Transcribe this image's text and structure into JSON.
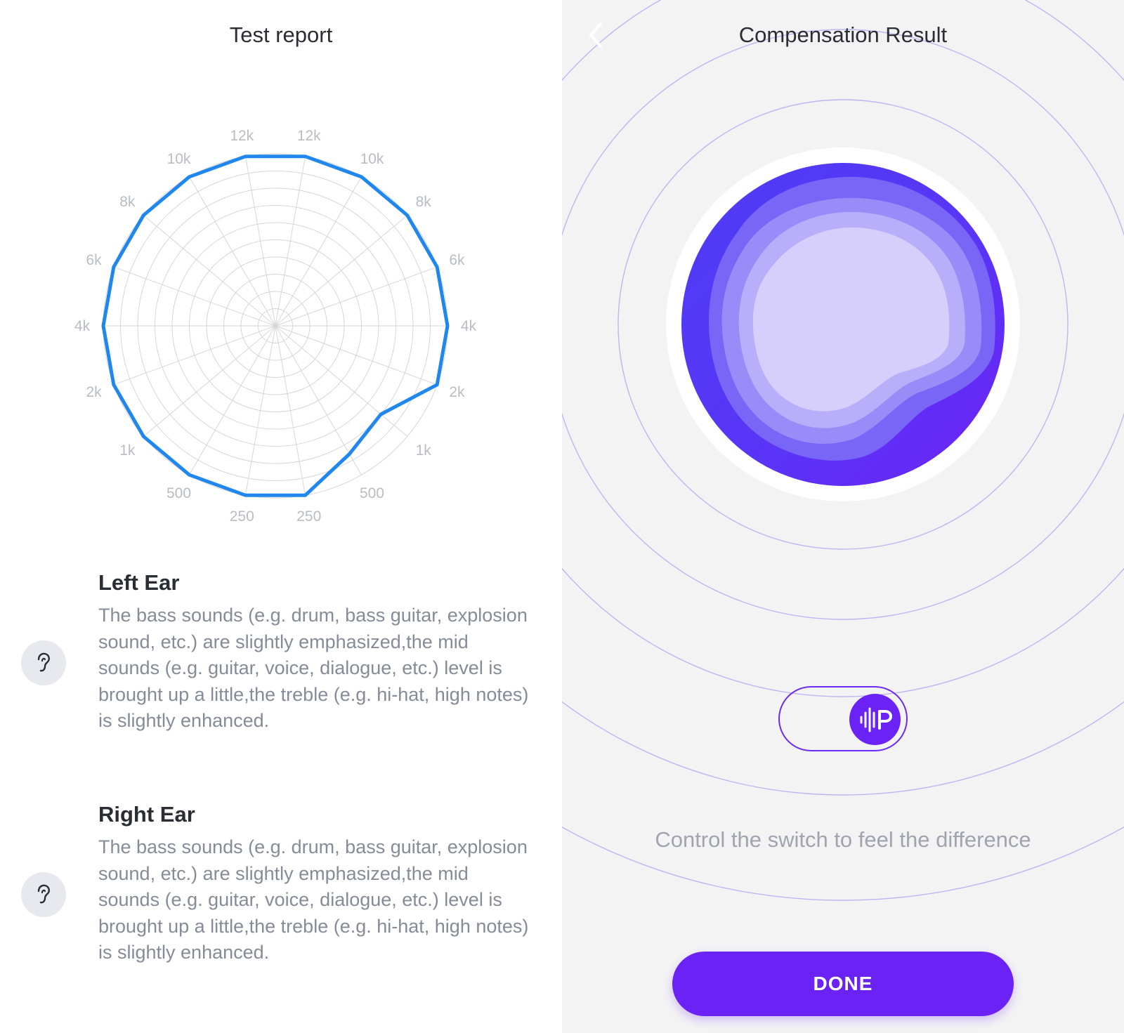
{
  "left": {
    "title": "Test report",
    "left_ear": {
      "heading": "Left Ear",
      "text": "The bass sounds (e.g. drum, bass guitar, explosion sound, etc.) are slightly emphasized,the mid sounds (e.g. guitar, voice, dialogue, etc.) level is brought up a little,the treble (e.g. hi-hat, high notes) is slightly enhanced.",
      "icon": "left-ear-icon"
    },
    "right_ear": {
      "heading": "Right Ear",
      "text": "The bass sounds (e.g. drum, bass guitar, explosion sound, etc.) are slightly emphasized,the mid sounds (e.g. guitar, voice, dialogue, etc.) level is brought up a little,the treble (e.g. hi-hat, high notes) is slightly enhanced.",
      "icon": "right-ear-icon"
    }
  },
  "right": {
    "title": "Compensation Result",
    "back_icon": "chevron-left-icon",
    "toggle_icon": "waveform-p-icon",
    "hint": "Control the switch to feel the difference",
    "done_label": "DONE"
  },
  "colors": {
    "radar_line": "#1f87ee",
    "grid": "#d6d6d9",
    "accent": "#6b22f5",
    "ring": "#b7b0f3",
    "tick_label": "#b9bcc3"
  },
  "chart_data": {
    "type": "radar",
    "title": "",
    "axes": [
      "12k",
      "10k",
      "8k",
      "6k",
      "4k",
      "2k",
      "1k",
      "500",
      "250",
      "250",
      "500",
      "1k",
      "2k",
      "4k",
      "6k",
      "8k",
      "10k",
      "12k"
    ],
    "rlim": [
      0,
      10
    ],
    "series": [
      {
        "values": [
          10,
          10,
          10,
          10,
          10,
          10,
          10,
          10,
          10,
          10,
          8.6,
          8.0,
          10,
          10,
          10,
          10,
          10,
          10
        ]
      }
    ],
    "grid": true
  }
}
